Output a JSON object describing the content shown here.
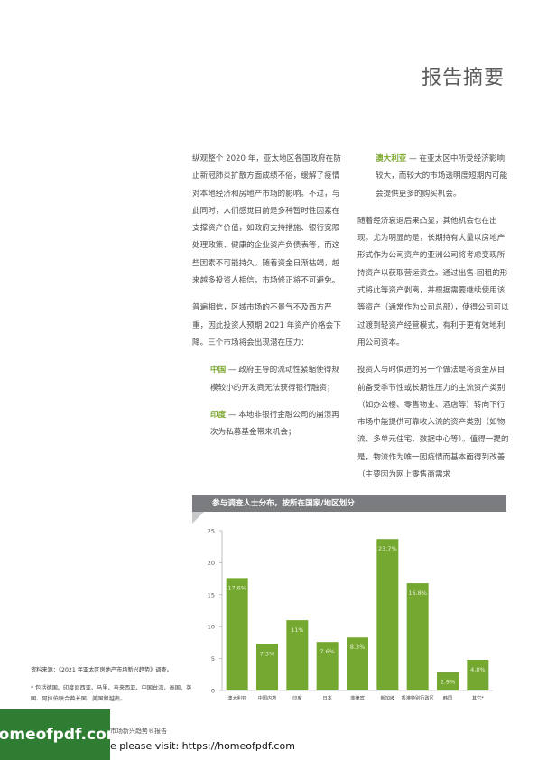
{
  "header": {
    "title": "报告摘要"
  },
  "left_column": {
    "p1": "纵观整个 2020 年，亚太地区各国政府在防止新冠肺炎扩散方面成绩不俗，缓解了疫情对本地经济和房地产市场的影响。不过，与此同时，人们感觉目前是多种暂时性因素在支撑资产价值，如政府支持措施、银行宽限处理政策、健康的企业资产负债表等，而这些因素不可能持久。随着资金日渐枯竭，越来越多投资人相信，市场修正将不可避免。",
    "p2": "普遍相信，区域市场的不景气不及西方严重，因此投资人预期 2021 年资产价格会下降。三个市场将会出现潜在压力：",
    "items": [
      {
        "label": "中国",
        "text": " — 政府主导的流动性紧缩使得规模较小的开发商无法获得银行融资；"
      },
      {
        "label": "印度",
        "text": " — 本地非银行金融公司的崩溃再次为私募基金带来机会；"
      }
    ]
  },
  "right_column": {
    "item": {
      "label": "澳大利亚",
      "text": " — 在亚太区中所受经济影响较大，而较大的市场透明度短期内可能会提供更多的购买机会。"
    },
    "p1": "随着经济衰退后果凸显，其他机会也在出现。尤为明显的是，长期持有大量以房地产形式作为公司资产的亚洲公司将考虑变现所持资产以获取营运资金。通过出售-回租的形式将此等资产剥离，并根据需要继续使用该等资产（通常作为公司总部），使得公司可以过渡到轻资产经营模式，有利于更有效地利用公司资本。",
    "p2": "投资人与时俱进的另一个做法是将资金从目前备受季节性或长期性压力的主流资产类别（如办公楼、零售物业、酒店等）转向下行市场中能提供可靠收入流的资产类别（如物流、多单元住宅、数据中心等）。值得一提的是，物流作为唯一因疫情而基本面得到改善（主要因为网上零售商需求"
  },
  "chart_title": "参与调查人士分布，按所在国家/地区划分",
  "chart_data": {
    "type": "bar",
    "title": "参与调查人士分布，按所在国家/地区划分",
    "categories": [
      "澳大利亚",
      "中国内地",
      "印度",
      "日本",
      "菲律宾",
      "新加坡",
      "香港特别行政区",
      "韩国",
      "其它*"
    ],
    "values": [
      17.6,
      7.3,
      11,
      7.6,
      8.3,
      23.7,
      16.8,
      2.9,
      4.8
    ],
    "value_labels": [
      "17.6%",
      "7.3%",
      "11%",
      "7.6%",
      "8.3%",
      "23.7%",
      "16.8%",
      "2.9%",
      "4.8%"
    ],
    "ylim": [
      0,
      25
    ],
    "yticks": [
      "0",
      "5",
      "10",
      "15",
      "20",
      "25"
    ],
    "xlabel": "",
    "ylabel": "",
    "bar_color": "#75a830",
    "grid": false
  },
  "source": {
    "line": "资料来源：《2021 年亚太区房地产市场新兴趋势》调查。",
    "note": "* 包括德国、印度尼西亚、马里、马来西亚、中国台湾、泰国、英国、阿拉伯联合酋长国、美国和越南。"
  },
  "footer": {
    "brand": "homeofpdf.com",
    "report_fragment": "市场新兴趋势®报告",
    "visit_text": "e please visit: https://homeofpdf.com"
  }
}
